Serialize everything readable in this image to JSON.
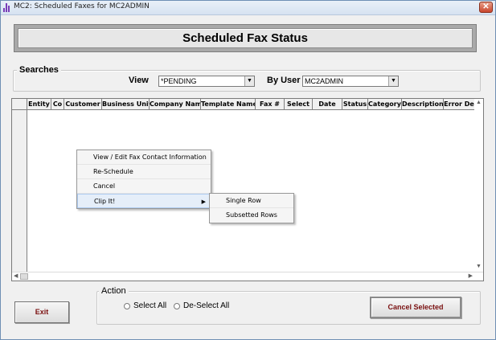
{
  "window": {
    "title": "MC2: Scheduled Faxes for MC2ADMIN",
    "close_glyph": "✕"
  },
  "banner": {
    "title": "Scheduled Fax Status"
  },
  "searches": {
    "label": "Searches",
    "view_label": "View",
    "view_value": "*PENDING",
    "user_label": "By User",
    "user_value": "MC2ADMIN"
  },
  "grid": {
    "columns": [
      "Entity",
      "Co",
      "Customer",
      "Business Unit",
      "Company Name",
      "Template Name",
      "Fax #",
      "Select",
      "Date",
      "Status",
      "Category",
      "Description",
      "Error De"
    ]
  },
  "context_menu": {
    "items": [
      "View / Edit Fax Contact Information",
      "Re-Schedule",
      "Cancel",
      "Clip It!"
    ],
    "submenu": [
      "Single Row",
      "Subsetted Rows"
    ]
  },
  "action": {
    "label": "Action",
    "select_all": "Select All",
    "deselect_all": "De-Select All"
  },
  "buttons": {
    "exit": "Exit",
    "cancel_selected": "Cancel Selected"
  },
  "colors": {
    "button_text": "#7a1010",
    "menu_highlight": "#e5eef9"
  }
}
